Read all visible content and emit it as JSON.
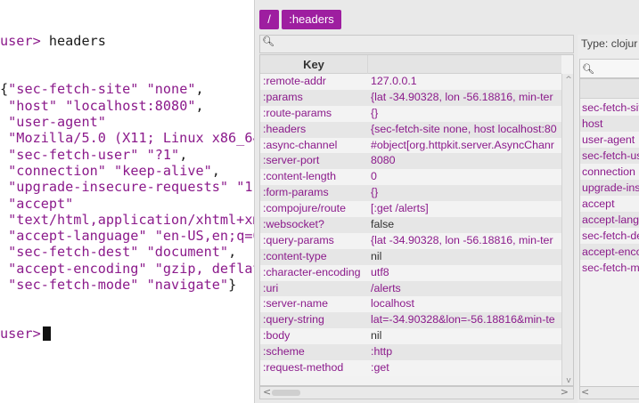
{
  "repl": {
    "prompt": "user>",
    "command": "headers",
    "output_lines": [
      "{\"sec-fetch-site\" \"none\",",
      " \"host\" \"localhost:8080\",",
      " \"user-agent\"",
      " \"Mozilla/5.0 (X11; Linux x86_64;",
      " \"sec-fetch-user\" \"?1\",",
      " \"connection\" \"keep-alive\",",
      " \"upgrade-insecure-requests\" \"1\",",
      " \"accept\"",
      " \"text/html,application/xhtml+xml,",
      " \"accept-language\" \"en-US,en;q=0.5",
      " \"sec-fetch-dest\" \"document\",",
      " \"accept-encoding\" \"gzip, deflate,",
      " \"sec-fetch-mode\" \"navigate\"}"
    ]
  },
  "inspector": {
    "breadcrumbs": [
      "/",
      ":headers"
    ],
    "search_icon": "search-icon",
    "table": {
      "key_header": "Key",
      "rows": [
        {
          "key": ":remote-addr",
          "value": "127.0.0.1",
          "value_style": "purple"
        },
        {
          "key": ":params",
          "value": "{lat -34.90328, lon -56.18816, min-ter",
          "value_style": "purple"
        },
        {
          "key": ":route-params",
          "value": "{}",
          "value_style": "purple"
        },
        {
          "key": ":headers",
          "value": "{sec-fetch-site none, host localhost:80",
          "value_style": "purple"
        },
        {
          "key": ":async-channel",
          "value": "#object[org.httpkit.server.AsyncChanr",
          "value_style": "purple"
        },
        {
          "key": ":server-port",
          "value": "8080",
          "value_style": "purple"
        },
        {
          "key": ":content-length",
          "value": "0",
          "value_style": "purple"
        },
        {
          "key": ":form-params",
          "value": "{}",
          "value_style": "purple"
        },
        {
          "key": ":compojure/route",
          "value": "[:get /alerts]",
          "value_style": "purple"
        },
        {
          "key": ":websocket?",
          "value": "false",
          "value_style": "plain"
        },
        {
          "key": ":query-params",
          "value": "{lat -34.90328, lon -56.18816, min-ter",
          "value_style": "purple"
        },
        {
          "key": ":content-type",
          "value": "nil",
          "value_style": "plain"
        },
        {
          "key": ":character-encoding",
          "value": "utf8",
          "value_style": "purple"
        },
        {
          "key": ":uri",
          "value": "/alerts",
          "value_style": "purple"
        },
        {
          "key": ":server-name",
          "value": "localhost",
          "value_style": "purple"
        },
        {
          "key": ":query-string",
          "value": "lat=-34.90328&lon=-56.18816&min-te",
          "value_style": "purple"
        },
        {
          "key": ":body",
          "value": "nil",
          "value_style": "plain"
        },
        {
          "key": ":scheme",
          "value": ":http",
          "value_style": "purple"
        },
        {
          "key": ":request-method",
          "value": ":get",
          "value_style": "purple"
        }
      ]
    },
    "right_pane": {
      "type_label": "Type: clojur",
      "items": [
        "sec-fetch-sit",
        "host",
        "user-agent",
        "sec-fetch-us",
        "connection",
        "upgrade-ins",
        "accept",
        "accept-langu",
        "sec-fetch-de",
        "accept-enco",
        "sec-fetch-m"
      ]
    },
    "scroll_arrows": {
      "up": "^",
      "down": "v",
      "left": "<",
      "right": ">"
    }
  },
  "colors": {
    "accent": "#9e1ea0",
    "keyword": "#8b1a8b",
    "row_even": "#e6e6e6",
    "row_odd": "#f3f3f3"
  }
}
